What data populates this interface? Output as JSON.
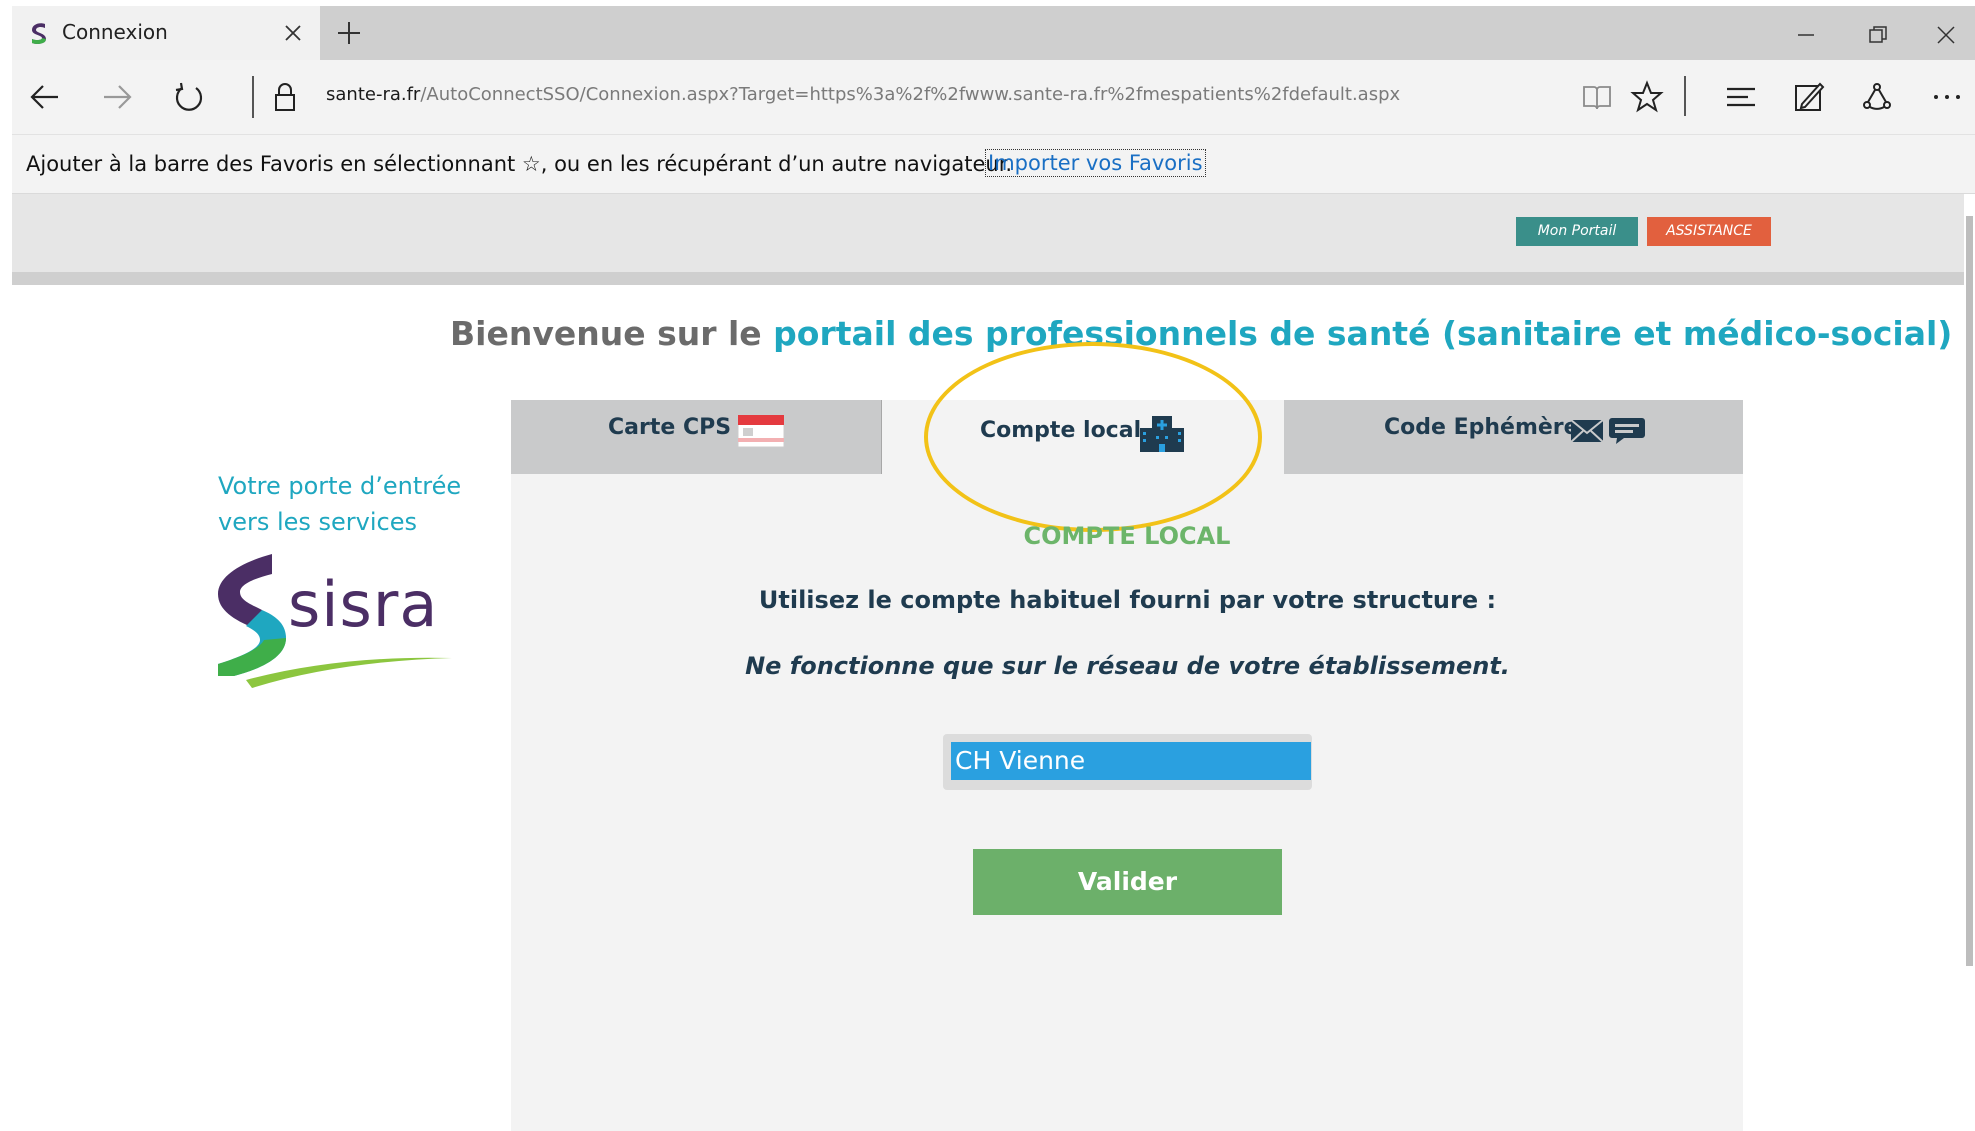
{
  "browser": {
    "tab_title": "Connexion",
    "url_host": "sante-ra.fr",
    "url_path": "/AutoConnectSSO/Connexion.aspx?Target=https%3a%2f%2fwww.sante-ra.fr%2fmespatients%2fdefault.aspx",
    "favorites_bar_text": "Ajouter à la barre des Favoris en sélectionnant ☆, ou en les récupérant d’un autre navigateur.",
    "favorites_bar_link": "Importer vos Favoris"
  },
  "header": {
    "mon_portail": "Mon Portail",
    "assistance": "ASSISTANCE"
  },
  "welcome": {
    "prefix": "Bienvenue sur le ",
    "highlight": "portail des professionnels de santé (sanitaire et médico-social)"
  },
  "sidebar": {
    "tagline_line1": "Votre porte d’entrée",
    "tagline_line2": "vers les services",
    "logo_text": "sisra"
  },
  "tabs": [
    {
      "label": "Carte CPS",
      "icon": "cps-card-icon",
      "active": false
    },
    {
      "label": "Compte local",
      "icon": "hospital-icon",
      "active": true
    },
    {
      "label": "Code Ephémère",
      "icon": "mail-chat-icon",
      "active": false
    }
  ],
  "login": {
    "section_title": "COMPTE LOCAL",
    "instruction": "Utilisez le compte habituel fourni par votre structure :",
    "note": "Ne fonctionne que sur le réseau de votre établissement.",
    "selected_structure": "CH Vienne",
    "submit_label": "Valider"
  },
  "colors": {
    "teal": "#1fa7c0",
    "green": "#6cb06a",
    "highlight_ring": "#f2c217",
    "select_bg": "#2aa0e0",
    "assistance": "#e2603e",
    "portail": "#3a8f8a"
  }
}
